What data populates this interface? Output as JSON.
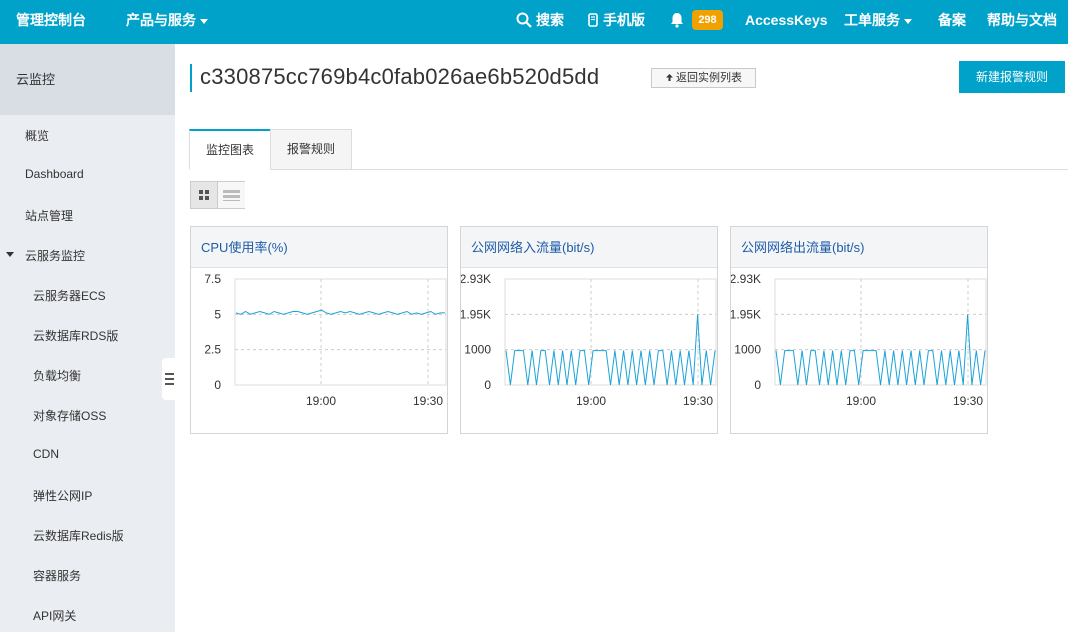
{
  "topbar": {
    "brand": "管理控制台",
    "products": "产品与服务",
    "search": "搜索",
    "mobile": "手机版",
    "badge_count": "298",
    "accesskeys": "AccessKeys",
    "tickets": "工单服务",
    "record": "备案",
    "help": "帮助与文档"
  },
  "sidebar": {
    "header": "云监控",
    "items": [
      {
        "label": "概览"
      },
      {
        "label": "Dashboard"
      },
      {
        "label": "站点管理"
      },
      {
        "label": "云服务监控"
      },
      {
        "label": "云服务器ECS"
      },
      {
        "label": "云数据库RDS版"
      },
      {
        "label": "负载均衡"
      },
      {
        "label": "对象存储OSS"
      },
      {
        "label": "CDN"
      },
      {
        "label": "弹性公网IP"
      },
      {
        "label": "云数据库Redis版"
      },
      {
        "label": "容器服务"
      },
      {
        "label": "API网关"
      }
    ]
  },
  "main": {
    "instance_id": "c330875cc769b4c0fab026ae6b520d5dd",
    "back_label": "返回实例列表",
    "new_rule_label": "新建报警规则",
    "tabs": [
      {
        "label": "监控图表"
      },
      {
        "label": "报警规则"
      }
    ]
  },
  "colors": {
    "accent": "#00a2ca",
    "badge": "#f0a100",
    "series": "#1aa3d9"
  },
  "chart_data": [
    {
      "type": "line",
      "title": "CPU使用率(%)",
      "yticks": [
        "7.5",
        "5",
        "2.5",
        "0"
      ],
      "xticks": [
        "19:00",
        "19:30"
      ],
      "ylim": [
        0,
        7.5
      ],
      "grid": true,
      "series": [
        {
          "values": [
            5.1,
            5.0,
            5.2,
            5.0,
            5.1,
            5.2,
            5.1,
            5.0,
            5.2,
            5.1,
            5.0,
            5.1,
            5.2,
            5.2,
            5.1,
            5.0,
            5.1,
            5.2,
            5.3,
            5.1,
            5.0,
            5.1,
            5.2,
            5.1,
            5.2,
            5.1,
            5.0,
            5.1,
            5.2,
            5.1,
            5.0,
            5.1,
            5.2,
            5.1,
            5.0,
            5.1,
            5.2,
            5.0,
            5.1,
            5.0,
            5.1,
            5.2,
            5.0,
            5.1,
            5.1
          ]
        }
      ]
    },
    {
      "type": "line",
      "title": "公网网络入流量(bit/s)",
      "yticks": [
        "2.93K",
        "1.95K",
        "1000",
        "0"
      ],
      "xticks": [
        "19:00",
        "19:30"
      ],
      "ylim": [
        0,
        2930
      ],
      "grid": true,
      "series": [
        {
          "values": [
            950,
            0,
            950,
            950,
            950,
            0,
            950,
            0,
            950,
            950,
            0,
            950,
            0,
            950,
            0,
            950,
            0,
            950,
            950,
            0,
            950,
            950,
            950,
            950,
            0,
            950,
            0,
            950,
            0,
            950,
            0,
            950,
            0,
            950,
            0,
            950,
            950,
            0,
            950,
            0,
            950,
            0,
            950,
            0,
            1950,
            0,
            950,
            0,
            950
          ]
        }
      ]
    },
    {
      "type": "line",
      "title": "公网网络出流量(bit/s)",
      "yticks": [
        "2.93K",
        "1.95K",
        "1000",
        "0"
      ],
      "xticks": [
        "19:00",
        "19:30"
      ],
      "ylim": [
        0,
        2930
      ],
      "grid": true,
      "series": [
        {
          "values": [
            950,
            0,
            950,
            950,
            950,
            0,
            950,
            0,
            950,
            950,
            0,
            950,
            0,
            950,
            0,
            950,
            0,
            950,
            950,
            0,
            950,
            950,
            950,
            950,
            0,
            950,
            0,
            950,
            0,
            950,
            0,
            950,
            0,
            950,
            0,
            950,
            950,
            0,
            950,
            0,
            950,
            0,
            950,
            0,
            1950,
            0,
            950,
            0,
            950
          ]
        }
      ]
    }
  ]
}
